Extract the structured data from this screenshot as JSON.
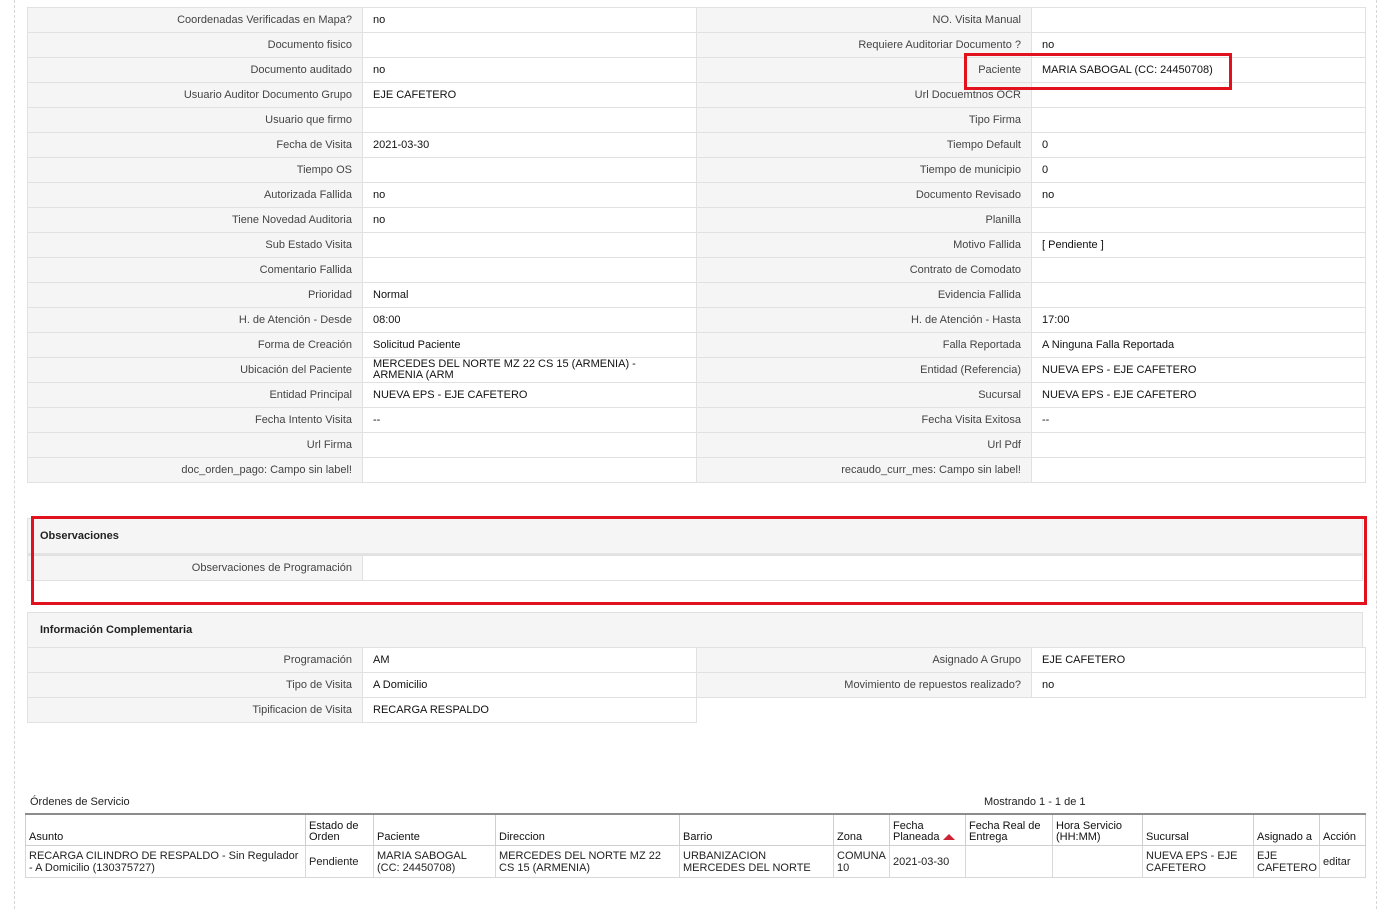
{
  "detail_rows": [
    {
      "l1": "Coordenadas Verificadas en Mapa?",
      "v1": "no",
      "l2": "NO. Visita Manual",
      "v2": ""
    },
    {
      "l1": "Documento fisico",
      "v1": "",
      "l2": "Requiere Auditoriar Documento ?",
      "v2": "no"
    },
    {
      "l1": "Documento auditado",
      "v1": "no",
      "l2": "Paciente",
      "v2": "MARIA SABOGAL (CC: 24450708)"
    },
    {
      "l1": "Usuario Auditor Documento Grupo",
      "v1": "EJE CAFETERO",
      "l2": "Url Docuemtnos OCR",
      "v2": ""
    },
    {
      "l1": "Usuario que firmo",
      "v1": "",
      "l2": "Tipo Firma",
      "v2": ""
    },
    {
      "l1": "Fecha de Visita",
      "v1": "2021-03-30",
      "l2": "Tiempo Default",
      "v2": "0"
    },
    {
      "l1": "Tiempo OS",
      "v1": "",
      "l2": "Tiempo de municipio",
      "v2": "0"
    },
    {
      "l1": "Autorizada Fallida",
      "v1": "no",
      "l2": "Documento Revisado",
      "v2": "no"
    },
    {
      "l1": "Tiene Novedad Auditoria",
      "v1": "no",
      "l2": "Planilla",
      "v2": ""
    },
    {
      "l1": "Sub Estado Visita",
      "v1": "",
      "l2": "Motivo Fallida",
      "v2": "[ Pendiente ]"
    },
    {
      "l1": "Comentario Fallida",
      "v1": "",
      "l2": "Contrato de Comodato",
      "v2": ""
    },
    {
      "l1": "Prioridad",
      "v1": "Normal",
      "l2": "Evidencia Fallida",
      "v2": ""
    },
    {
      "l1": "H. de Atención - Desde",
      "v1": "08:00",
      "l2": "H. de Atención - Hasta",
      "v2": "17:00"
    },
    {
      "l1": "Forma de Creación",
      "v1": "Solicitud Paciente",
      "l2": "Falla Reportada",
      "v2": "A Ninguna Falla Reportada"
    },
    {
      "l1": "Ubicación del Paciente",
      "v1": "MERCEDES DEL NORTE MZ 22 CS 15 (ARMENIA) - ARMENIA (ARM",
      "l2": "Entidad (Referencia)",
      "v2": "NUEVA EPS - EJE CAFETERO"
    },
    {
      "l1": "Entidad Principal",
      "v1": "NUEVA EPS - EJE CAFETERO",
      "l2": "Sucursal",
      "v2": "NUEVA EPS - EJE CAFETERO"
    },
    {
      "l1": "Fecha Intento Visita",
      "v1": "--",
      "l2": "Fecha Visita Exitosa",
      "v2": "--"
    },
    {
      "l1": "Url Firma",
      "v1": "",
      "l2": "Url Pdf",
      "v2": ""
    },
    {
      "l1": "doc_orden_pago: Campo sin label!",
      "v1": "",
      "l2": "recaudo_curr_mes: Campo sin label!",
      "v2": ""
    }
  ],
  "observaciones": {
    "title": "Observaciones",
    "label": "Observaciones de Programación",
    "value": ""
  },
  "complementaria": {
    "title": "Información Complementaria",
    "rows": [
      {
        "l1": "Programación",
        "v1": "AM",
        "l2": "Asignado A Grupo",
        "v2": "EJE CAFETERO"
      },
      {
        "l1": "Tipo de Visita",
        "v1": "A Domicilio",
        "l2": "Movimiento de repuestos realizado?",
        "v2": "no"
      },
      {
        "l1": "Tipificacion de Visita",
        "v1": "RECARGA RESPALDO",
        "l2": "",
        "v2": ""
      }
    ]
  },
  "ordenes": {
    "title": "Órdenes de Servicio",
    "count": "Mostrando 1 - 1 de 1",
    "columns": [
      "Asunto",
      "Estado de Orden",
      "Paciente",
      "Direccion",
      "Barrio",
      "Zona",
      "Fecha Planeada",
      "Fecha Real de Entrega",
      "Hora Servicio (HH:MM)",
      "Sucursal",
      "Asignado a",
      "Acción"
    ],
    "rows": [
      [
        "RECARGA CILINDRO DE RESPALDO - Sin Regulador - A Domicilio (130375727)",
        "Pendiente",
        "MARIA SABOGAL (CC: 24450708)",
        "MERCEDES DEL NORTE MZ 22 CS 15 (ARMENIA)",
        "URBANIZACION MERCEDES DEL NORTE",
        "COMUNA 10",
        "2021-03-30",
        "",
        "",
        "NUEVA EPS - EJE CAFETERO",
        "EJE CAFETERO",
        "editar"
      ]
    ]
  },
  "colors": {
    "highlight": "#e1111e",
    "label_bg": "#f5f5f5"
  }
}
